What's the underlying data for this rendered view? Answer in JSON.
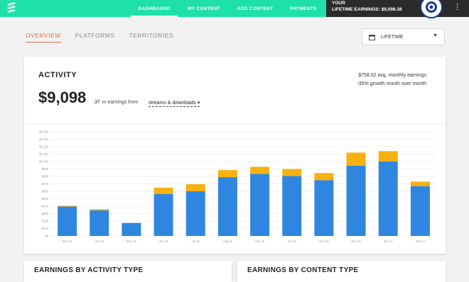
{
  "nav": {
    "items": [
      {
        "label": "DASHBOARD",
        "active": true
      },
      {
        "label": "MY CONTENT",
        "active": false
      },
      {
        "label": "ADD CONTENT",
        "active": false
      },
      {
        "label": "PAYMENTS",
        "active": false
      }
    ],
    "earnings_label": "YOUR",
    "earnings_amount": "LIFETIME EARNINGS: $9,098.38",
    "menu_icon": "kebab-icon",
    "logo_icon": "stacked-logo-icon",
    "avatar_icon": "avatar-icon"
  },
  "tabs": [
    {
      "label": "OVERVIEW",
      "active": true
    },
    {
      "label": "PLATFORMS",
      "active": false
    },
    {
      "label": "TERRITORIES",
      "active": false
    }
  ],
  "period_select": {
    "value": "LIFETIME",
    "icon": "calendar-icon"
  },
  "activity": {
    "title": "ACTIVITY",
    "amount": "$9,098",
    "cents": ".37",
    "earnings_text": "in earnings from",
    "source": "streams & downloads ▾",
    "avg_text": "$758.02 avg. monthly earnings",
    "growth_text": "-35% growth month over month"
  },
  "colors": {
    "accent": "#1ee0a8",
    "tab_active": "#f06a3a",
    "bar_blue": "#2f86e0",
    "bar_orange": "#f9b10f"
  },
  "chart_data": {
    "type": "bar",
    "stacked": true,
    "categories": [
      "Mar 16",
      "Apr 16",
      "May 16",
      "Jun 16",
      "Jul 16",
      "Aug 16",
      "Sep 16",
      "Oct 16",
      "Nov 16",
      "Dec 16",
      "Jan 17",
      "Feb 17"
    ],
    "series": [
      {
        "values": [
          395,
          345,
          175,
          565,
          600,
          790,
          835,
          805,
          750,
          945,
          1000,
          670
        ]
      },
      {
        "values": [
          10,
          15,
          0,
          85,
          95,
          95,
          95,
          95,
          95,
          175,
          140,
          60
        ]
      }
    ],
    "y_ticks": [
      "$0",
      "$100",
      "$200",
      "$300",
      "$400",
      "$500",
      "$600",
      "$700",
      "$800",
      "$900",
      "$1,000",
      "$1,100",
      "$1,200",
      "$1,300",
      "$1,400"
    ],
    "ylim": [
      0,
      1400
    ],
    "grid": true
  },
  "bottom_cards": [
    {
      "title": "EARNINGS BY ACTIVITY TYPE"
    },
    {
      "title": "EARNINGS BY CONTENT TYPE"
    }
  ]
}
